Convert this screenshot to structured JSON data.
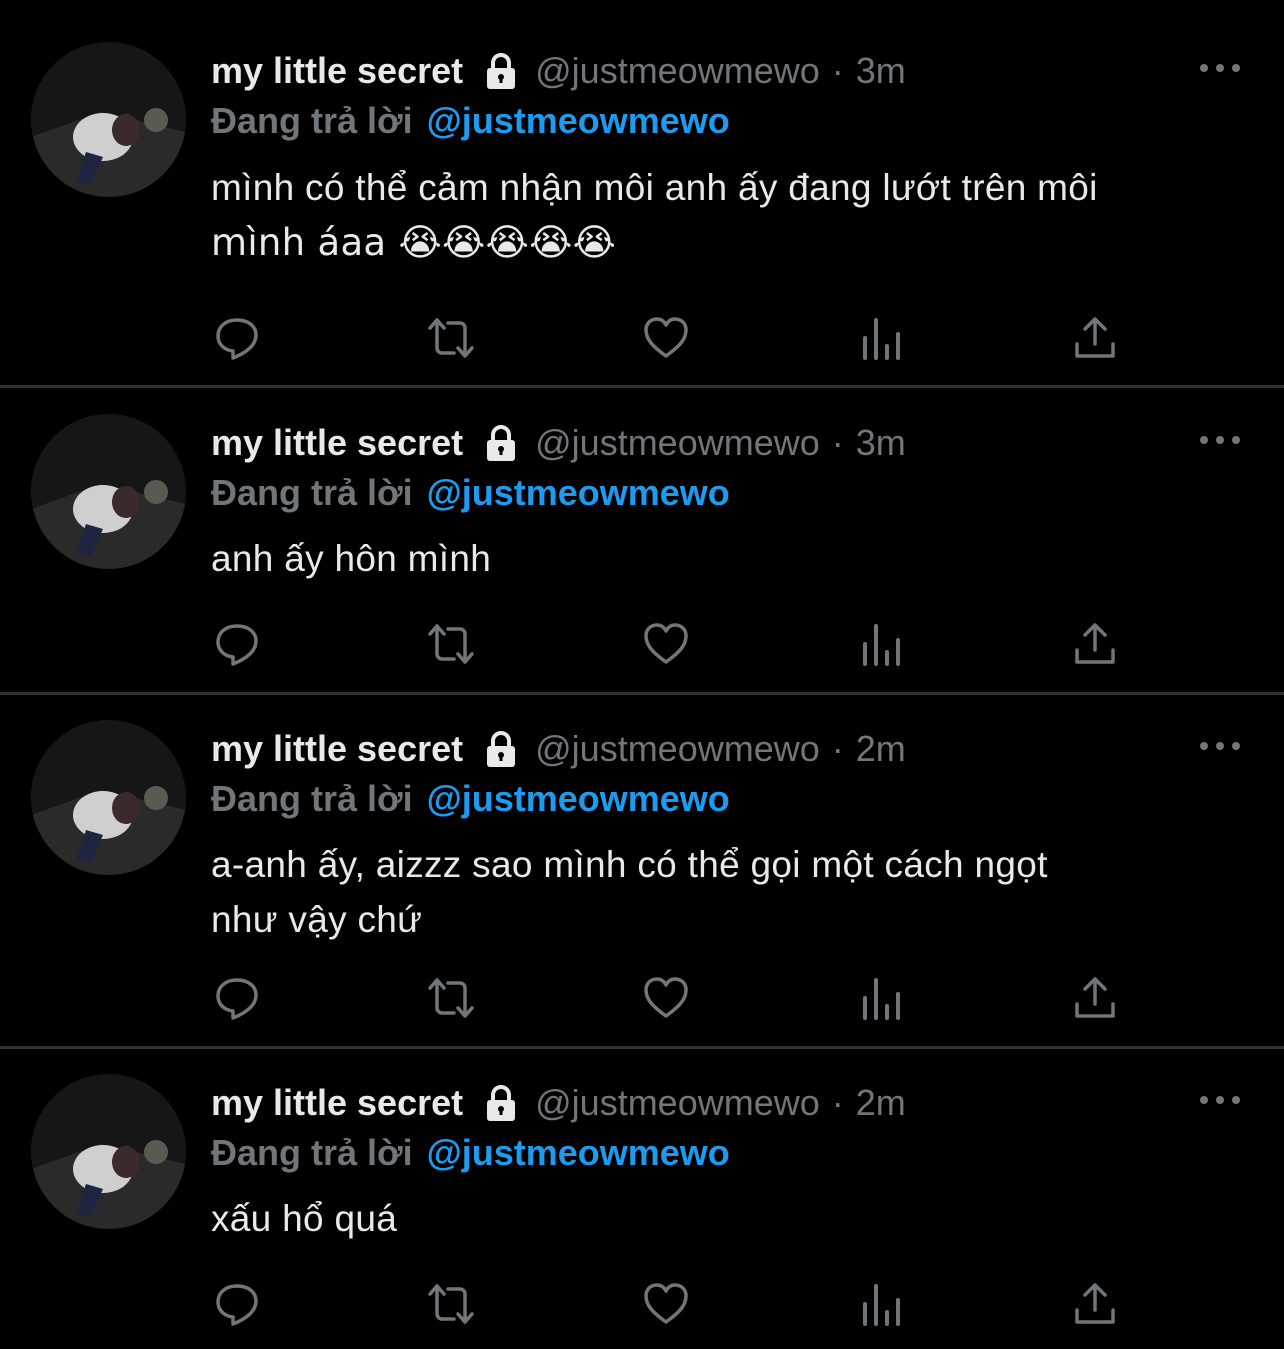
{
  "colors": {
    "background": "#000000",
    "primary_text": "#e7e9ea",
    "secondary_text": "#71767b",
    "accent": "#1d9bf0",
    "divider": "#2f3336"
  },
  "tweets": [
    {
      "name": "my little secret",
      "handle": "@justmeowmewo",
      "separator": "·",
      "time": "3m",
      "reply_prefix": "Đang trả lời",
      "reply_handle": "@justmeowmewo",
      "text_lines": [
        "mình có thể cảm nhận môi anh ấy đang lướt trên môi",
        "mình áaa 😭😭😭😭😭"
      ],
      "icons": {
        "lock": "lock-icon",
        "more": "more-icon",
        "reply": "reply-icon",
        "retweet": "retweet-icon",
        "like": "like-icon",
        "views": "views-icon",
        "share": "share-icon"
      }
    },
    {
      "name": "my little secret",
      "handle": "@justmeowmewo",
      "separator": "·",
      "time": "3m",
      "reply_prefix": "Đang trả lời",
      "reply_handle": "@justmeowmewo",
      "text_lines": [
        "anh ấy hôn mình"
      ],
      "icons": {
        "lock": "lock-icon",
        "more": "more-icon",
        "reply": "reply-icon",
        "retweet": "retweet-icon",
        "like": "like-icon",
        "views": "views-icon",
        "share": "share-icon"
      }
    },
    {
      "name": "my little secret",
      "handle": "@justmeowmewo",
      "separator": "·",
      "time": "2m",
      "reply_prefix": "Đang trả lời",
      "reply_handle": "@justmeowmewo",
      "text_lines": [
        "a-anh ấy, aizzz sao mình có thể gọi một cách ngọt",
        "như vậy chứ"
      ],
      "icons": {
        "lock": "lock-icon",
        "more": "more-icon",
        "reply": "reply-icon",
        "retweet": "retweet-icon",
        "like": "like-icon",
        "views": "views-icon",
        "share": "share-icon"
      }
    },
    {
      "name": "my little secret",
      "handle": "@justmeowmewo",
      "separator": "·",
      "time": "2m",
      "reply_prefix": "Đang trả lời",
      "reply_handle": "@justmeowmewo",
      "text_lines": [
        "xấu hổ quá"
      ],
      "icons": {
        "lock": "lock-icon",
        "more": "more-icon",
        "reply": "reply-icon",
        "retweet": "retweet-icon",
        "like": "like-icon",
        "views": "views-icon",
        "share": "share-icon"
      }
    }
  ]
}
